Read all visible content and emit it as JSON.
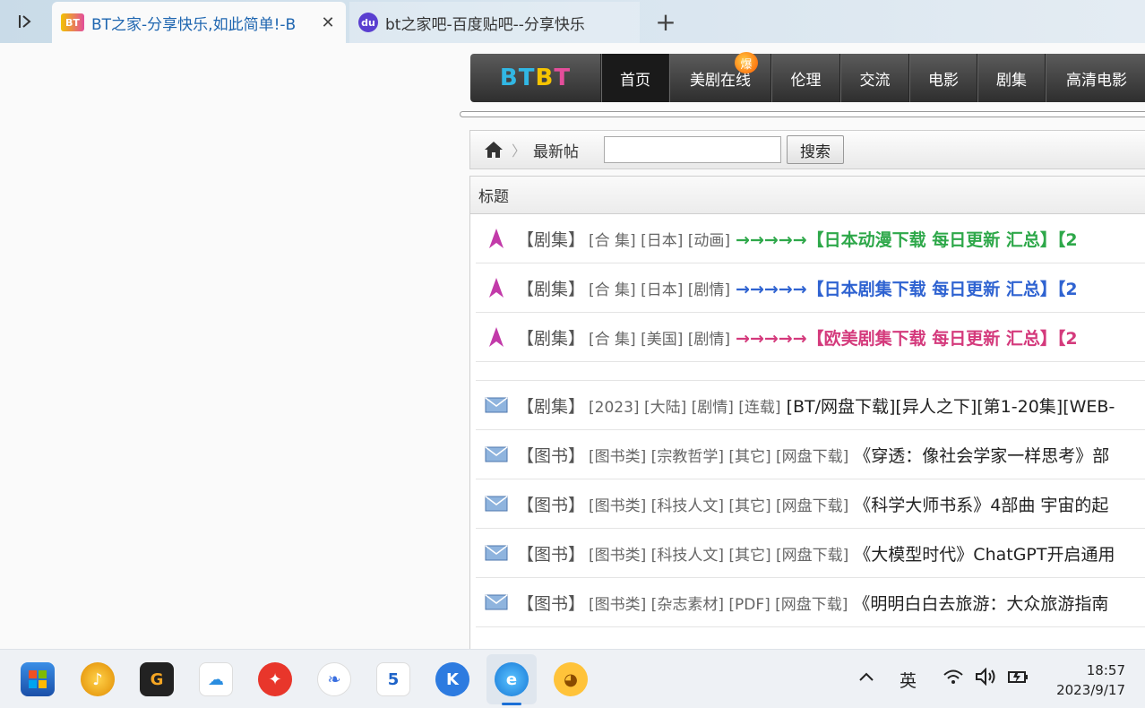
{
  "browser": {
    "tabs": [
      {
        "title": "BT之家-分享快乐,如此简单!-B",
        "favicon": "bt-favicon-icon",
        "active": true
      },
      {
        "title": "bt之家吧-百度贴吧--分享快乐",
        "favicon": "baidu-paw-icon",
        "active": false
      }
    ]
  },
  "site": {
    "logo": {
      "part1": "BT",
      "part2": "B",
      "part3": "T"
    },
    "nav": [
      {
        "label": "首页",
        "active": true
      },
      {
        "label": "美剧在线",
        "badge": "爆"
      },
      {
        "label": "伦理"
      },
      {
        "label": "交流"
      },
      {
        "label": "电影"
      },
      {
        "label": "剧集"
      },
      {
        "label": "高清电影"
      }
    ],
    "breadcrumb": {
      "current": "最新帖"
    },
    "search": {
      "value": "",
      "button_label": "搜索"
    },
    "list_header": "标题",
    "pinned": [
      {
        "category": "【剧集】",
        "tags": "[合 集] [日本] [动画]",
        "title": "→→→→→【日本动漫下载 每日更新 汇总】【2",
        "color": "green"
      },
      {
        "category": "【剧集】",
        "tags": "[合 集] [日本] [剧情]",
        "title": "→→→→→【日本剧集下载 每日更新 汇总】【2",
        "color": "blue"
      },
      {
        "category": "【剧集】",
        "tags": "[合 集] [美国] [剧情]",
        "title": "→→→→→【欧美剧集下载 每日更新 汇总】【2",
        "color": "red"
      }
    ],
    "threads": [
      {
        "category": "【剧集】",
        "tags": "[2023] [大陆] [剧情] [连载]",
        "title": "[BT/网盘下载][异人之下][第1-20集][WEB-"
      },
      {
        "category": "【图书】",
        "tags": "[图书类] [宗教哲学] [其它] [网盘下载]",
        "title": "《穿透：像社会学家一样思考》部"
      },
      {
        "category": "【图书】",
        "tags": "[图书类] [科技人文] [其它] [网盘下载]",
        "title": "《科学大师书系》4部曲 宇宙的起"
      },
      {
        "category": "【图书】",
        "tags": "[图书类] [科技人文] [其它] [网盘下载]",
        "title": "《大模型时代》ChatGPT开启通用"
      },
      {
        "category": "【图书】",
        "tags": "[图书类] [杂志素材] [PDF] [网盘下载]",
        "title": "《明明白白去旅游：大众旅游指南"
      }
    ]
  },
  "taskbar": {
    "apps": [
      "store-icon",
      "music-app-icon",
      "g-app-icon",
      "cloud-drive-icon",
      "red-bird-app-icon",
      "feather-app-icon",
      "5-app-icon",
      "k-app-icon",
      "edge-browser-icon",
      "tv-app-icon"
    ],
    "ime": "英",
    "time": "18:57",
    "date": "2023/9/17"
  },
  "colors": {
    "pin_green": "#2ea84a",
    "pin_blue": "#2f63d1",
    "pin_red": "#d43a7c",
    "tab_active_text": "#1f66b0"
  }
}
